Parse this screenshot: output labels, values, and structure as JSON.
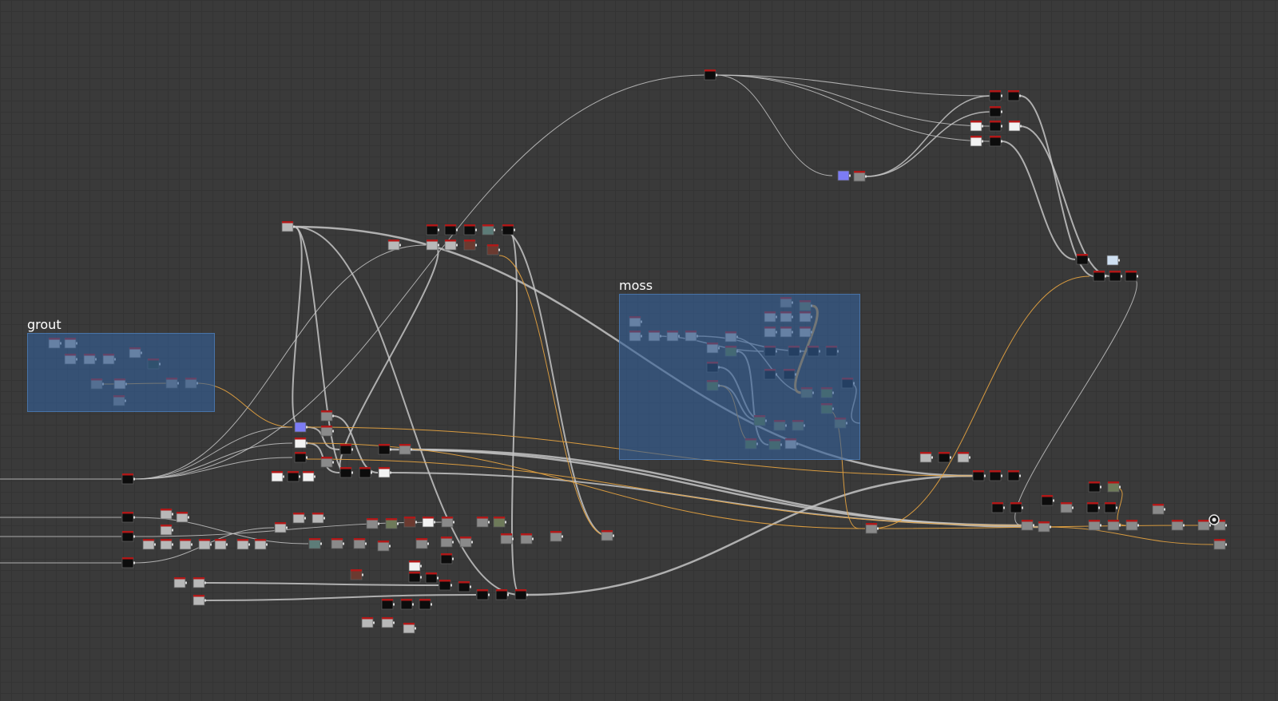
{
  "frames": [
    {
      "id": "grout",
      "title": "grout"
    },
    {
      "id": "moss",
      "title": "moss"
    }
  ],
  "output_node_icon": "output-target-icon"
}
